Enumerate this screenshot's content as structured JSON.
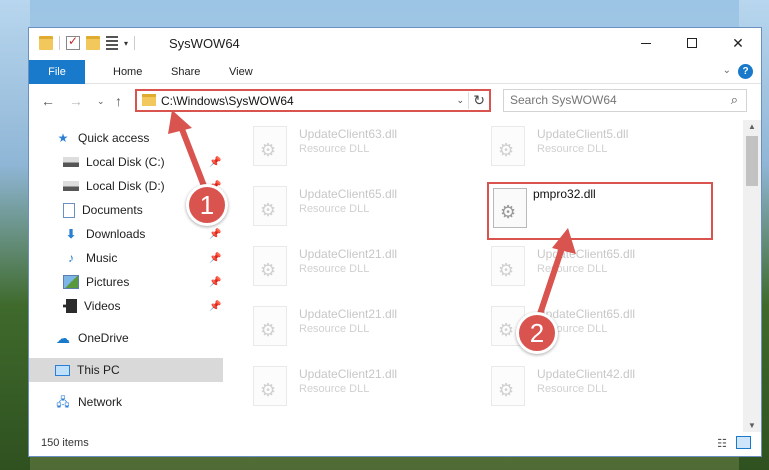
{
  "window": {
    "title": "SysWOW64",
    "controls": {
      "minimize": "minimize",
      "maximize": "maximize",
      "close": "✕"
    }
  },
  "ribbon": {
    "tabs": [
      "File",
      "Home",
      "Share",
      "View"
    ],
    "help": "?"
  },
  "nav": {
    "back": "←",
    "forward": "→",
    "recent": "⌄",
    "up": "↑"
  },
  "address": {
    "path": "C:\\Windows\\SysWOW64",
    "refresh": "↻"
  },
  "search": {
    "placeholder": "Search SysWOW64"
  },
  "sidebar": {
    "items": [
      {
        "label": "Quick access",
        "icon": "star-icon"
      },
      {
        "label": "Local Disk (C:)",
        "icon": "disk-icon",
        "pinned": true
      },
      {
        "label": "Local Disk (D:)",
        "icon": "disk-icon",
        "pinned": true
      },
      {
        "label": "Documents",
        "icon": "document-icon",
        "pinned": true
      },
      {
        "label": "Downloads",
        "icon": "download-icon",
        "pinned": true
      },
      {
        "label": "Music",
        "icon": "music-icon",
        "pinned": true
      },
      {
        "label": "Pictures",
        "icon": "pictures-icon",
        "pinned": true
      },
      {
        "label": "Videos",
        "icon": "videos-icon",
        "pinned": true
      },
      {
        "label": "OneDrive",
        "icon": "cloud-icon"
      },
      {
        "label": "This PC",
        "icon": "computer-icon",
        "selected": true
      },
      {
        "label": "Network",
        "icon": "network-icon"
      }
    ]
  },
  "files": [
    {
      "name": "UpdateClient63.dll",
      "type": "Resource DLL"
    },
    {
      "name": "UpdateClient5.dll",
      "type": "Resource DLL"
    },
    {
      "name": "UpdateClient65.dll",
      "type": "Resource DLL"
    },
    {
      "name": "pmpro32.dll",
      "type": "",
      "highlighted": true
    },
    {
      "name": "UpdateClient21.dll",
      "type": "Resource DLL"
    },
    {
      "name": "UpdateClient65.dll",
      "type": "Resource DLL"
    },
    {
      "name": "UpdateClient21.dll",
      "type": "Resource DLL"
    },
    {
      "name": "UpdateClient65.dll",
      "type": "Resource DLL"
    },
    {
      "name": "UpdateClient21.dll",
      "type": "Resource DLL"
    },
    {
      "name": "UpdateClient42.dll",
      "type": "Resource DLL"
    }
  ],
  "status": {
    "count": "150 items"
  },
  "annotations": {
    "marker1": "1",
    "marker2": "2",
    "color": "#d9534f"
  }
}
